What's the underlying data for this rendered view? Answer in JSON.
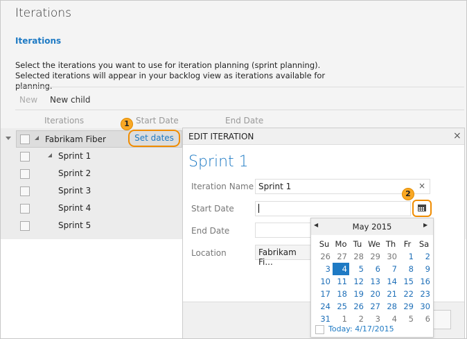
{
  "page": {
    "title": "Iterations",
    "subtitle": "Iterations",
    "description": "Select the iterations you want to use for iteration planning (sprint planning). Selected iterations will appear in your backlog view as iterations available for planning."
  },
  "toolbar": {
    "new": "New",
    "new_child": "New child"
  },
  "columns": {
    "iterations": "Iterations",
    "start": "Start Date",
    "end": "End Date"
  },
  "tree": [
    {
      "label": "Fabrikam Fiber",
      "action": "Set dates"
    },
    {
      "label": "Sprint 1"
    },
    {
      "label": "Sprint 2"
    },
    {
      "label": "Sprint 3"
    },
    {
      "label": "Sprint 4"
    },
    {
      "label": "Sprint 5"
    }
  ],
  "callouts": [
    "1",
    "2"
  ],
  "dialog": {
    "header": "EDIT ITERATION",
    "close": "×",
    "name": "Sprint 1",
    "labels": {
      "name": "Iteration Name",
      "start": "Start Date",
      "end": "End Date",
      "location": "Location"
    },
    "values": {
      "name": "Sprint 1",
      "start": "",
      "end": "",
      "location": "Fabrikam Fi..."
    },
    "clear": "×"
  },
  "calendar": {
    "month": "May 2015",
    "prev": "◀",
    "next": "▶",
    "dow": [
      "Su",
      "Mo",
      "Tu",
      "We",
      "Th",
      "Fr",
      "Sa"
    ],
    "weeks": [
      [
        "26",
        "27",
        "28",
        "29",
        "30",
        "1",
        "2"
      ],
      [
        "3",
        "4",
        "5",
        "6",
        "7",
        "8",
        "9"
      ],
      [
        "10",
        "11",
        "12",
        "13",
        "14",
        "15",
        "16"
      ],
      [
        "17",
        "18",
        "19",
        "20",
        "21",
        "22",
        "23"
      ],
      [
        "24",
        "25",
        "26",
        "27",
        "28",
        "29",
        "30"
      ],
      [
        "31",
        "1",
        "2",
        "3",
        "4",
        "5",
        "6"
      ]
    ],
    "selected": "4",
    "today": "Today: 4/17/2015"
  },
  "colors": {
    "accent": "#1e7ac4",
    "callout": "#f08c00",
    "badge": "#f9a825"
  }
}
